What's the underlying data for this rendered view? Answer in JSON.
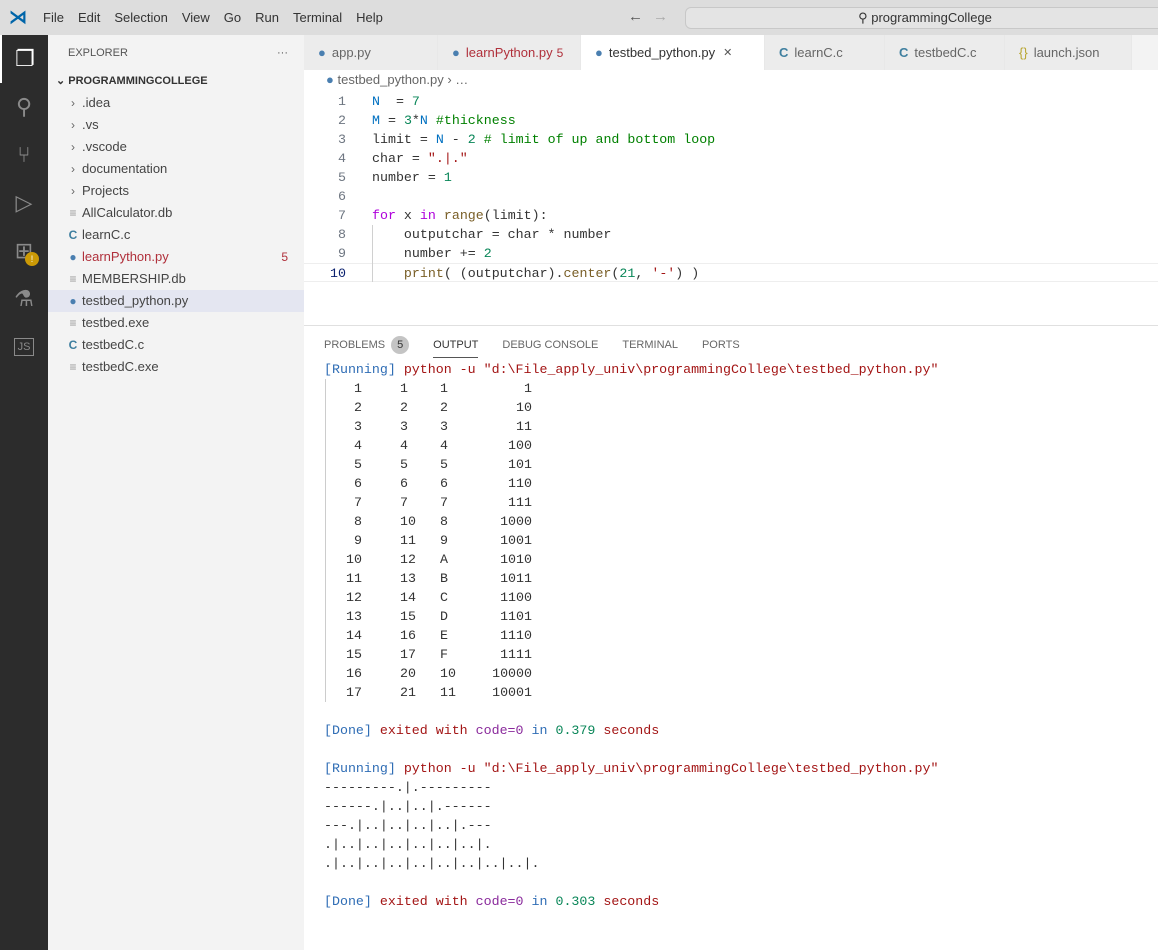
{
  "menu": [
    "File",
    "Edit",
    "Selection",
    "View",
    "Go",
    "Run",
    "Terminal",
    "Help"
  ],
  "search": "programmingCollege",
  "explorer": {
    "title": "EXPLORER",
    "root": "PROGRAMMINGCOLLEGE",
    "items": [
      {
        "label": ".idea",
        "type": "folder"
      },
      {
        "label": ".vs",
        "type": "folder"
      },
      {
        "label": ".vscode",
        "type": "folder"
      },
      {
        "label": "documentation",
        "type": "folder"
      },
      {
        "label": "Projects",
        "type": "folder"
      },
      {
        "label": "AllCalculator.db",
        "type": "file"
      },
      {
        "label": "learnC.c",
        "type": "c"
      },
      {
        "label": "learnPython.py",
        "type": "py",
        "badge": "5",
        "error": true
      },
      {
        "label": "MEMBERSHIP.db",
        "type": "file"
      },
      {
        "label": "testbed_python.py",
        "type": "py",
        "selected": true
      },
      {
        "label": "testbed.exe",
        "type": "file"
      },
      {
        "label": "testbedC.c",
        "type": "c"
      },
      {
        "label": "testbedC.exe",
        "type": "file"
      }
    ]
  },
  "tabs": [
    {
      "label": "app.py",
      "icon": "python"
    },
    {
      "label": "learnPython.py",
      "badge": "5",
      "icon": "python",
      "error": true
    },
    {
      "label": "testbed_python.py",
      "icon": "python",
      "active": true
    },
    {
      "label": "learnC.c",
      "icon": "c"
    },
    {
      "label": "testbedC.c",
      "icon": "c"
    },
    {
      "label": "launch.json",
      "icon": "json"
    }
  ],
  "breadcrumb": {
    "file": "testbed_python.py",
    "rest": "…"
  },
  "code": [
    "N  = 7",
    "M = 3*N #thickness",
    "limit = N - 2 # limit of up and bottom loop",
    "char = \".|.\"",
    "number = 1",
    "",
    "for x in range(limit):",
    "    outputchar = char * number",
    "    number += 2",
    "    print( (outputchar).center(21, '-') )"
  ],
  "panel": {
    "tabs": [
      "PROBLEMS",
      "OUTPUT",
      "DEBUG CONSOLE",
      "TERMINAL",
      "PORTS"
    ],
    "problems_count": "5",
    "active": "OUTPUT"
  },
  "run1": {
    "running": "[Running]",
    "cmd": "python -u \"d:\\File_apply_univ\\programmingCollege\\testbed_python.py\"",
    "rows": [
      [
        "1",
        "1",
        "1",
        "1"
      ],
      [
        "2",
        "2",
        "2",
        "10"
      ],
      [
        "3",
        "3",
        "3",
        "11"
      ],
      [
        "4",
        "4",
        "4",
        "100"
      ],
      [
        "5",
        "5",
        "5",
        "101"
      ],
      [
        "6",
        "6",
        "6",
        "110"
      ],
      [
        "7",
        "7",
        "7",
        "111"
      ],
      [
        "8",
        "10",
        "8",
        "1000"
      ],
      [
        "9",
        "11",
        "9",
        "1001"
      ],
      [
        "10",
        "12",
        "A",
        "1010"
      ],
      [
        "11",
        "13",
        "B",
        "1011"
      ],
      [
        "12",
        "14",
        "C",
        "1100"
      ],
      [
        "13",
        "15",
        "D",
        "1101"
      ],
      [
        "14",
        "16",
        "E",
        "1110"
      ],
      [
        "15",
        "17",
        "F",
        "1111"
      ],
      [
        "16",
        "20",
        "10",
        "10000"
      ],
      [
        "17",
        "21",
        "11",
        "10001"
      ]
    ],
    "done": "[Done]",
    "exited": "exited with",
    "code": "code=0",
    "in": "in",
    "time": "0.379",
    "seconds": "seconds"
  },
  "run2": {
    "running": "[Running]",
    "cmd": "python -u \"d:\\File_apply_univ\\programmingCollege\\testbed_python.py\"",
    "lines": [
      "---------.|.---------",
      "------.|..|..|.------",
      "---.|..|..|..|..|.---",
      ".|..|..|..|..|..|..|.",
      ".|..|..|..|..|..|..|..|..|."
    ],
    "done": "[Done]",
    "exited": "exited with",
    "code": "code=0",
    "in": "in",
    "time": "0.303",
    "seconds": "seconds"
  }
}
